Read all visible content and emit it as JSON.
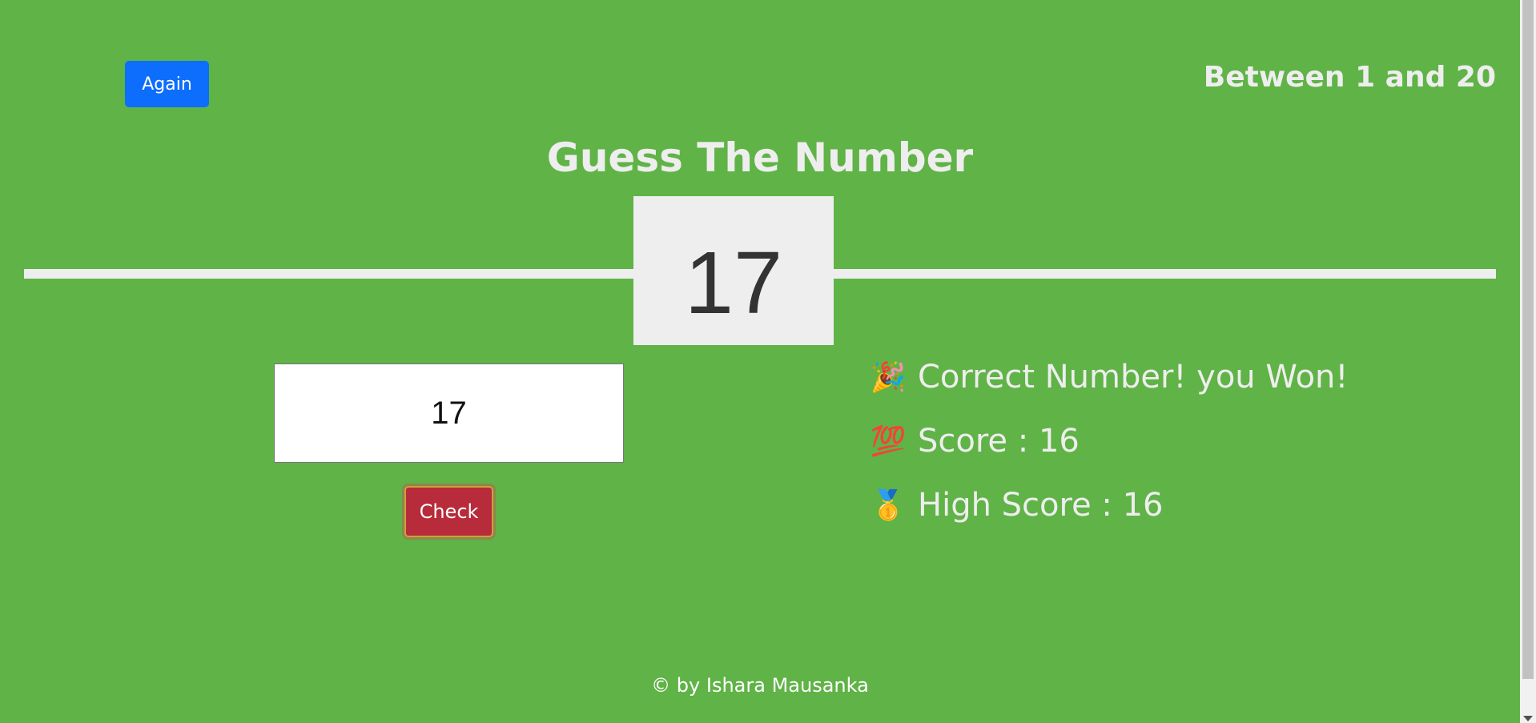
{
  "header": {
    "again_label": "Again",
    "range_text": "Between 1 and 20",
    "title": "Guess The Number"
  },
  "secret": {
    "number": "17"
  },
  "guess": {
    "input_value": "17",
    "check_label": "Check"
  },
  "status": {
    "message_icon": "party-popper-icon",
    "message_emoji": "🎉",
    "message": "Correct Number! you Won!",
    "score_icon": "hundred-points-icon",
    "score_emoji": "💯",
    "score_text": "Score : 16",
    "highscore_icon": "medal-icon",
    "highscore_emoji": "🥇",
    "highscore_text": "High Score : 16"
  },
  "footer": {
    "credit": "© by Ishara Mausanka"
  },
  "colors": {
    "background": "#60b347",
    "again_button": "#0d6efd",
    "check_button": "#b82b3a",
    "number_box": "#eeeeee"
  }
}
